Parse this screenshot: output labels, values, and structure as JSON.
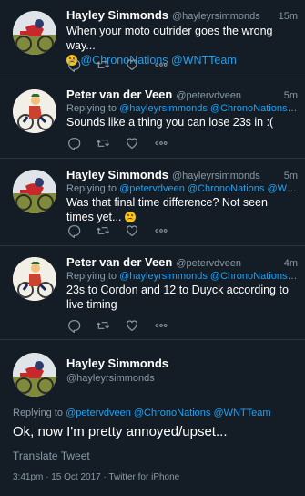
{
  "tweets": [
    {
      "name": "Hayley Simmonds",
      "handle": "@hayleyrsimmonds",
      "time": "15m",
      "text_line1": "When your moto outrider goes the wrong way...",
      "mentions": "@ChronoNations @WNTTeam"
    },
    {
      "name": "Peter van der Veen",
      "handle": "@petervdveen",
      "time": "5m",
      "replying_label": "Replying to",
      "replying_links": "@hayleyrsimmonds @ChronoNations @...",
      "text": "Sounds like a thing you can lose 23s in :("
    },
    {
      "name": "Hayley Simmonds",
      "handle": "@hayleyrsimmonds",
      "time": "5m",
      "replying_label": "Replying to",
      "replying_links": "@petervdveen @ChronoNations @WNTT...",
      "text": "Was that final time difference? Not seen times yet..."
    },
    {
      "name": "Peter van der Veen",
      "handle": "@petervdveen",
      "time": "4m",
      "replying_label": "Replying to",
      "replying_links": "@hayleyrsimmonds @ChronoNations @WNT...",
      "text": "23s to Cordon and 12 to Duyck according to live timing"
    }
  ],
  "main": {
    "name": "Hayley Simmonds",
    "handle": "@hayleyrsimmonds",
    "replying_label": "Replying to",
    "replying_links": "@petervdveen @ChronoNations @WNTTeam",
    "text": "Ok, now I'm pretty annoyed/upset...",
    "translate": "Translate Tweet",
    "meta": "3:41pm · 15 Oct 2017 · Twitter for iPhone"
  },
  "icons": [
    "reply-icon",
    "retweet-icon",
    "like-icon",
    "more-icon",
    "emoji-face-icon"
  ],
  "colors": {
    "background": "#141d26",
    "link": "#1da1f2",
    "muted": "#8899a6",
    "divider": "#243447"
  }
}
